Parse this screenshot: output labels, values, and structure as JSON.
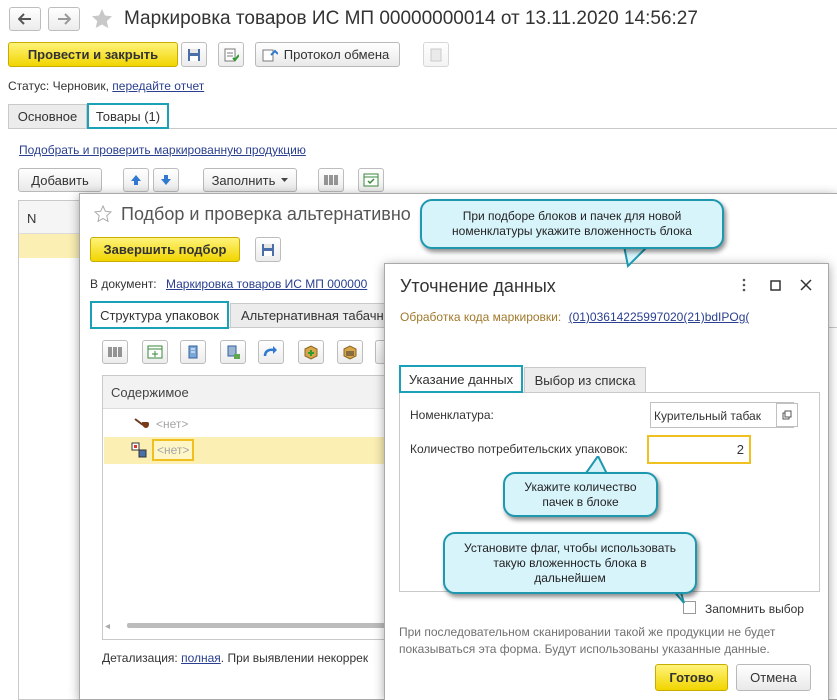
{
  "main": {
    "title": "Маркировка товаров ИС МП 00000000014 от 13.11.2020 14:56:27",
    "post_close": "Провести и закрыть",
    "exchange_protocol": "Протокол обмена",
    "status_label": "Статус:",
    "status_value": "Черновик,",
    "status_link": "передайте отчет",
    "tabs": [
      "Основное",
      "Товары (1)"
    ],
    "pick_link": "Подобрать и проверить маркированную продукцию",
    "add": "Добавить",
    "fill": "Заполнить",
    "col_n": "N"
  },
  "picker": {
    "title": "Подбор и проверка альтернативно",
    "finish": "Завершить подбор",
    "doc_label": "В документ:",
    "doc_link": "Маркировка товаров ИС МП 000000",
    "tabs": [
      "Структура упаковок",
      "Альтернативная табачна"
    ],
    "col_content": "Содержимое",
    "row1": "<нет>",
    "row2": "<нет>",
    "detail_label": "Детализация:",
    "detail_link": "полная",
    "detail_rest": ". При выявлении некоррек"
  },
  "dialog": {
    "title": "Уточнение данных",
    "code_label": "Обработка кода маркировки:",
    "code_link": "(01)03614225997020(21)bdIPOg(",
    "tabs": [
      "Указание данных",
      "Выбор из списка"
    ],
    "nom_label": "Номенклатура:",
    "nom_value": "Курительный табак",
    "qty_label": "Количество потребительских упаковок:",
    "qty_value": "2",
    "remember": "Запомнить выбор",
    "note": "При последовательном сканировании такой же продукции не будет показываться эта форма. Будут использованы указанные данные.",
    "ok": "Готово",
    "cancel": "Отмена"
  },
  "callouts": {
    "c1": "При подборе блоков и пачек для новой номенклатуры укажите вложенность блока",
    "c2": "Укажите количество пачек в блоке",
    "c3": "Установите флаг, чтобы использовать такую вложенность блока в дальнейшем"
  },
  "colors": {
    "accent_teal": "#1aa1b8",
    "yellow_button": "#f1d500",
    "link": "#2a3f8f"
  }
}
